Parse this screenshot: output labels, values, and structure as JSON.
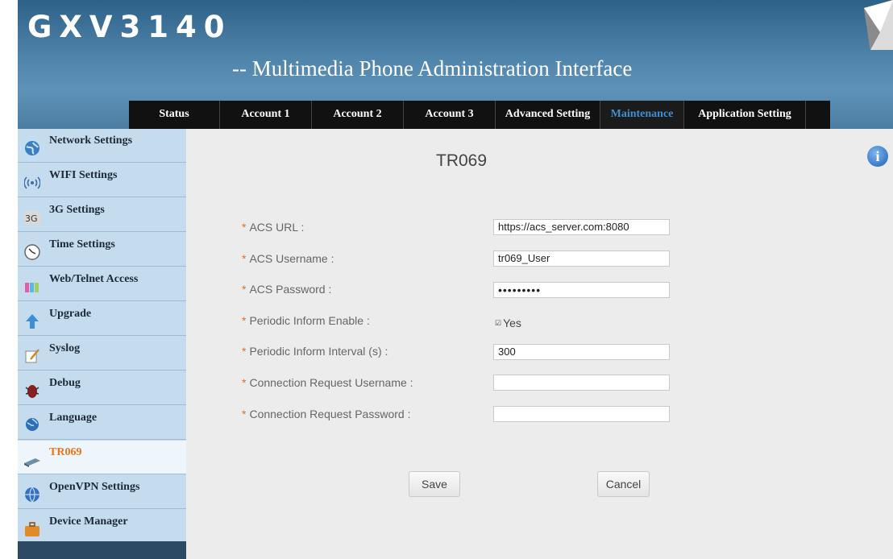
{
  "app": {
    "brand": "GXV3140",
    "subtitle": "-- Multimedia Phone Administration Interface"
  },
  "nav": {
    "tabs": [
      {
        "label": "Status",
        "active": false
      },
      {
        "label": "Account 1",
        "active": false
      },
      {
        "label": "Account 2",
        "active": false
      },
      {
        "label": "Account 3",
        "active": false
      },
      {
        "label": "Advanced Setting",
        "active": false
      },
      {
        "label": "Maintenance",
        "active": true
      },
      {
        "label": "Application Setting",
        "active": false
      }
    ]
  },
  "sidebar": {
    "items": [
      {
        "label": "Network Settings",
        "icon": "globe-icon"
      },
      {
        "label": "WIFI Settings",
        "icon": "wifi-icon"
      },
      {
        "label": "3G Settings",
        "icon": "3g-icon"
      },
      {
        "label": "Time Settings",
        "icon": "clock-icon"
      },
      {
        "label": "Web/Telnet Access",
        "icon": "web-access-icon"
      },
      {
        "label": "Upgrade",
        "icon": "upgrade-arrow-icon"
      },
      {
        "label": "Syslog",
        "icon": "syslog-icon"
      },
      {
        "label": "Debug",
        "icon": "bug-icon"
      },
      {
        "label": "Language",
        "icon": "language-globe-icon"
      },
      {
        "label": "TR069",
        "icon": "tr069-device-icon",
        "active": true
      },
      {
        "label": "OpenVPN Settings",
        "icon": "vpn-globe-icon"
      },
      {
        "label": "Device Manager",
        "icon": "briefcase-icon"
      }
    ]
  },
  "page": {
    "title": "TR069",
    "info_icon": "i"
  },
  "form": {
    "acs_url": {
      "label": "ACS URL :",
      "value": "https://acs_server.com:8080"
    },
    "acs_username": {
      "label": "ACS Username :",
      "value": "tr069_User"
    },
    "acs_password": {
      "label": "ACS Password :",
      "value": "•••••••••"
    },
    "periodic_inform_enable": {
      "label": "Periodic Inform Enable :",
      "checked": true,
      "option": "Yes"
    },
    "periodic_inform_interval": {
      "label": "Periodic Inform Interval (s) :",
      "value": "300"
    },
    "connection_request_username": {
      "label": "Connection Request Username :",
      "value": ""
    },
    "connection_request_password": {
      "label": "Connection Request Password :",
      "value": ""
    },
    "required_marker": "*"
  },
  "buttons": {
    "save": "Save",
    "cancel": "Cancel"
  },
  "colors": {
    "header": "#4f84ab",
    "nav": "#111111",
    "active_tab": "#3d8fd6",
    "sidebar": "#c4dcee",
    "active_sidebar_label": "#e8761f",
    "required_star": "#e07020"
  }
}
